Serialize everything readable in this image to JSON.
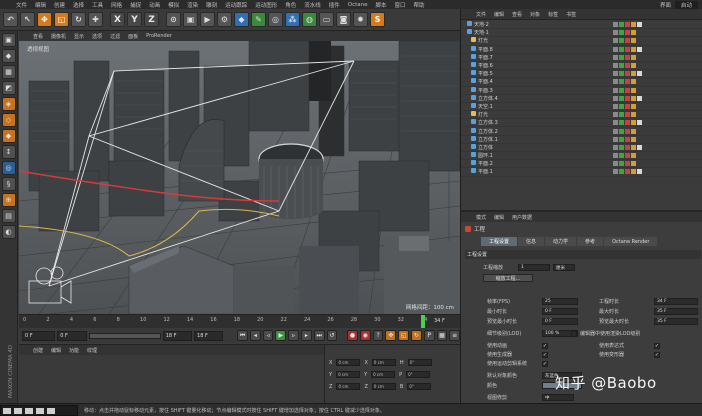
{
  "menubar": {
    "items": [
      "文件",
      "编辑",
      "创建",
      "选择",
      "工具",
      "网格",
      "捕捉",
      "动画",
      "模拟",
      "渲染",
      "雕刻",
      "运动跟踪",
      "运动图形",
      "角色",
      "流水线",
      "插件",
      "Octane",
      "脚本",
      "窗口",
      "帮助"
    ],
    "layout_label": "界面",
    "layout_value": "启动"
  },
  "toolbar": {
    "buttons": [
      {
        "name": "undo-icon",
        "glyph": "↶"
      },
      {
        "name": "live-select-icon",
        "glyph": "↖"
      },
      {
        "name": "move-icon",
        "glyph": "✥"
      },
      {
        "name": "scale-icon",
        "glyph": "◱"
      },
      {
        "name": "rotate-icon",
        "glyph": "↻"
      },
      {
        "name": "last-tool-icon",
        "glyph": "✚"
      }
    ],
    "axes": [
      "X",
      "Y",
      "Z"
    ],
    "extra_icons": [
      "world-coord-icon",
      "render-view-icon",
      "render-picture-icon",
      "render-settings-icon",
      "cube-icon",
      "pen-icon",
      "subdivision-icon",
      "array-icon",
      "deformer-icon",
      "floor-icon",
      "camera-icon",
      "light-icon",
      "script-icon"
    ]
  },
  "viewport": {
    "menu": [
      "查看",
      "摄像机",
      "显示",
      "选项",
      "过滤",
      "面板",
      "ProRender"
    ],
    "label": "透视视图",
    "grid_spacing": "网格间距：100 cm"
  },
  "timeline": {
    "ticks": [
      "0",
      "2",
      "4",
      "6",
      "8",
      "10",
      "12",
      "14",
      "16",
      "18",
      "20",
      "22",
      "24",
      "26",
      "28",
      "30",
      "32",
      "34"
    ],
    "current_frame": 34,
    "end_label": "34 F"
  },
  "transport": {
    "start_field": "0 F",
    "preview_start": "0 F",
    "end_field": "18 F",
    "preview_end": "18 F"
  },
  "materials": {
    "menu": [
      "创建",
      "编辑",
      "功能",
      "纹理"
    ]
  },
  "coordinates": {
    "rows": [
      {
        "axis": "X",
        "v1": "0 cm",
        "axis2": "X",
        "v2": "0 cm",
        "axis3": "H",
        "v3": "0°"
      },
      {
        "axis": "Y",
        "v1": "0 cm",
        "axis2": "Y",
        "v2": "0 cm",
        "axis3": "P",
        "v3": "0°"
      },
      {
        "axis": "Z",
        "v1": "0 cm",
        "axis2": "Z",
        "v2": "0 cm",
        "axis3": "B",
        "v3": "0°"
      }
    ]
  },
  "objects": {
    "menu": [
      "文件",
      "编辑",
      "查看",
      "对象",
      "标签",
      "书签"
    ],
    "rows": [
      {
        "name": "天地·2",
        "color": "#5aa0e0",
        "sel": false
      },
      {
        "name": "天地·1",
        "color": "#5aa0e0",
        "sel": false
      },
      {
        "name": "灯光",
        "color": "#e0c050",
        "sel": false
      },
      {
        "name": "平面.8",
        "color": "#5aa0e0",
        "sel": false
      },
      {
        "name": "平面.7",
        "color": "#5aa0e0",
        "sel": false
      },
      {
        "name": "平面.6",
        "color": "#5aa0e0",
        "sel": false
      },
      {
        "name": "平面.5",
        "color": "#5aa0e0",
        "sel": false
      },
      {
        "name": "平面.4",
        "color": "#5aa0e0",
        "sel": false
      },
      {
        "name": "平面.3",
        "color": "#5aa0e0",
        "sel": false
      },
      {
        "name": "立方体.4",
        "color": "#5aa0e0",
        "sel": false
      },
      {
        "name": "天空.1",
        "color": "#5aa0e0",
        "sel": false
      },
      {
        "name": "灯光",
        "color": "#e0c050",
        "sel": false
      },
      {
        "name": "立方体.3",
        "color": "#5aa0e0",
        "sel": false
      },
      {
        "name": "立方体.2",
        "color": "#5aa0e0",
        "sel": false
      },
      {
        "name": "立方体.1",
        "color": "#5aa0e0",
        "sel": false
      },
      {
        "name": "立方体",
        "color": "#5aa0e0",
        "sel": false
      },
      {
        "name": "圆环.1",
        "color": "#5aa0e0",
        "sel": false
      },
      {
        "name": "平面.2",
        "color": "#5aa0e0",
        "sel": false
      },
      {
        "name": "平面.1",
        "color": "#5aa0e0",
        "sel": false
      }
    ]
  },
  "attributes": {
    "menu": [
      "模式",
      "编辑",
      "用户数据"
    ],
    "title": "工程",
    "tabs": [
      "工程设置",
      "信息",
      "动力学",
      "参考",
      "Octane Render"
    ],
    "section": "工程设置",
    "scale_label": "工程缩放",
    "scale_value": "1",
    "scale_unit": "厘米",
    "play_button": "缩放工程...",
    "fields_left": [
      {
        "label": "帧率(FPS)",
        "value": "25"
      },
      {
        "label": "最小时长",
        "value": "0 F"
      },
      {
        "label": "预览最小时长",
        "value": "0 F"
      }
    ],
    "fields_right": [
      {
        "label": "工程时长",
        "value": "34 F"
      },
      {
        "label": "最大时长",
        "value": "35 F"
      },
      {
        "label": "预览最大时长",
        "value": "35 F"
      }
    ],
    "lod_label": "细节级别(LOD)",
    "lod_value": "100 %",
    "lod_check": "编辑器中使用渲染LOD级别",
    "checks_left": [
      "使用动画",
      "使用生成器",
      "使用运动剪辑系统"
    ],
    "checks_right": [
      "使用表达式",
      "使用变形器"
    ],
    "default_color_label": "默认对象颜色",
    "default_color_value": "灰蓝色",
    "color_label": "颜色",
    "view_label": "视图修剪",
    "view_value": "中"
  },
  "status": {
    "text": "移动：点击并拖动鼠标移动元素，按住 SHIFT 键量化移动；节点编辑模式时按住 SHIFT 键增加选择对象；按住 CTRL 键减少选择对象。"
  },
  "watermark": "知乎 @Baobo",
  "brand_vertical": "MAXON CINEMA 4D"
}
